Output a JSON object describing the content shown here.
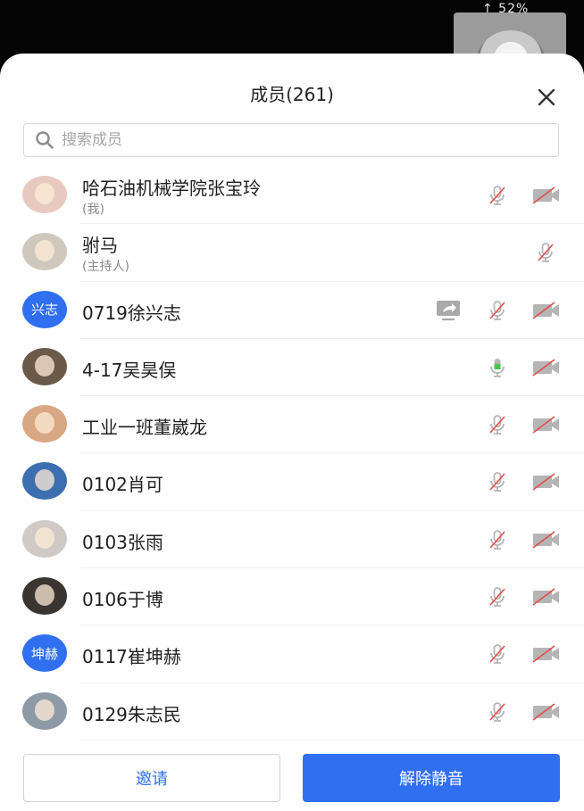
{
  "status_bar": {
    "text": "↑ 52%"
  },
  "header": {
    "title": "成员(261)"
  },
  "search": {
    "placeholder": "搜索成员"
  },
  "members": [
    {
      "name": "哈石油机械学院张宝玲",
      "sub": "(我)",
      "avatar": "photo",
      "avatar_color": "#e8c9c0",
      "mic": "muted",
      "cam": "off",
      "share": false
    },
    {
      "name": "驸马",
      "sub": "(主持人)",
      "avatar": "photo",
      "avatar_color": "#cfc9bd",
      "mic": "muted",
      "cam": "none",
      "share": false
    },
    {
      "name": "0719徐兴志",
      "sub": "",
      "avatar": "text",
      "avatar_text": "兴志",
      "mic": "muted",
      "cam": "off",
      "share": true
    },
    {
      "name": "4-17吴昊俣",
      "sub": "",
      "avatar": "photo",
      "avatar_color": "#6b5a4a",
      "mic": "on",
      "cam": "off",
      "share": false
    },
    {
      "name": " 工业一班董崴龙",
      "sub": "",
      "avatar": "photo",
      "avatar_color": "#d8a784",
      "mic": "muted",
      "cam": "off",
      "share": false
    },
    {
      "name": "0102肖可",
      "sub": "",
      "avatar": "photo",
      "avatar_color": "#3d6fb0",
      "mic": "muted",
      "cam": "off",
      "share": false
    },
    {
      "name": "0103张雨",
      "sub": "",
      "avatar": "photo",
      "avatar_color": "#cfcac6",
      "mic": "muted",
      "cam": "off",
      "share": false
    },
    {
      "name": "0106于博",
      "sub": "",
      "avatar": "photo",
      "avatar_color": "#3a3530",
      "mic": "muted",
      "cam": "off",
      "share": false
    },
    {
      "name": "0117崔坤赫",
      "sub": "",
      "avatar": "text",
      "avatar_text": "坤赫",
      "mic": "muted",
      "cam": "off",
      "share": false
    },
    {
      "name": "0129朱志民",
      "sub": "",
      "avatar": "photo",
      "avatar_color": "#8e9aa6",
      "mic": "muted",
      "cam": "off",
      "share": false
    }
  ],
  "footer": {
    "invite_label": "邀请",
    "unmute_label": "解除静音"
  },
  "colors": {
    "accent": "#2f6ff0",
    "muted_icon": "#b5b5b5",
    "mic_on": "#4cc44c",
    "strike": "#e64b4b"
  }
}
